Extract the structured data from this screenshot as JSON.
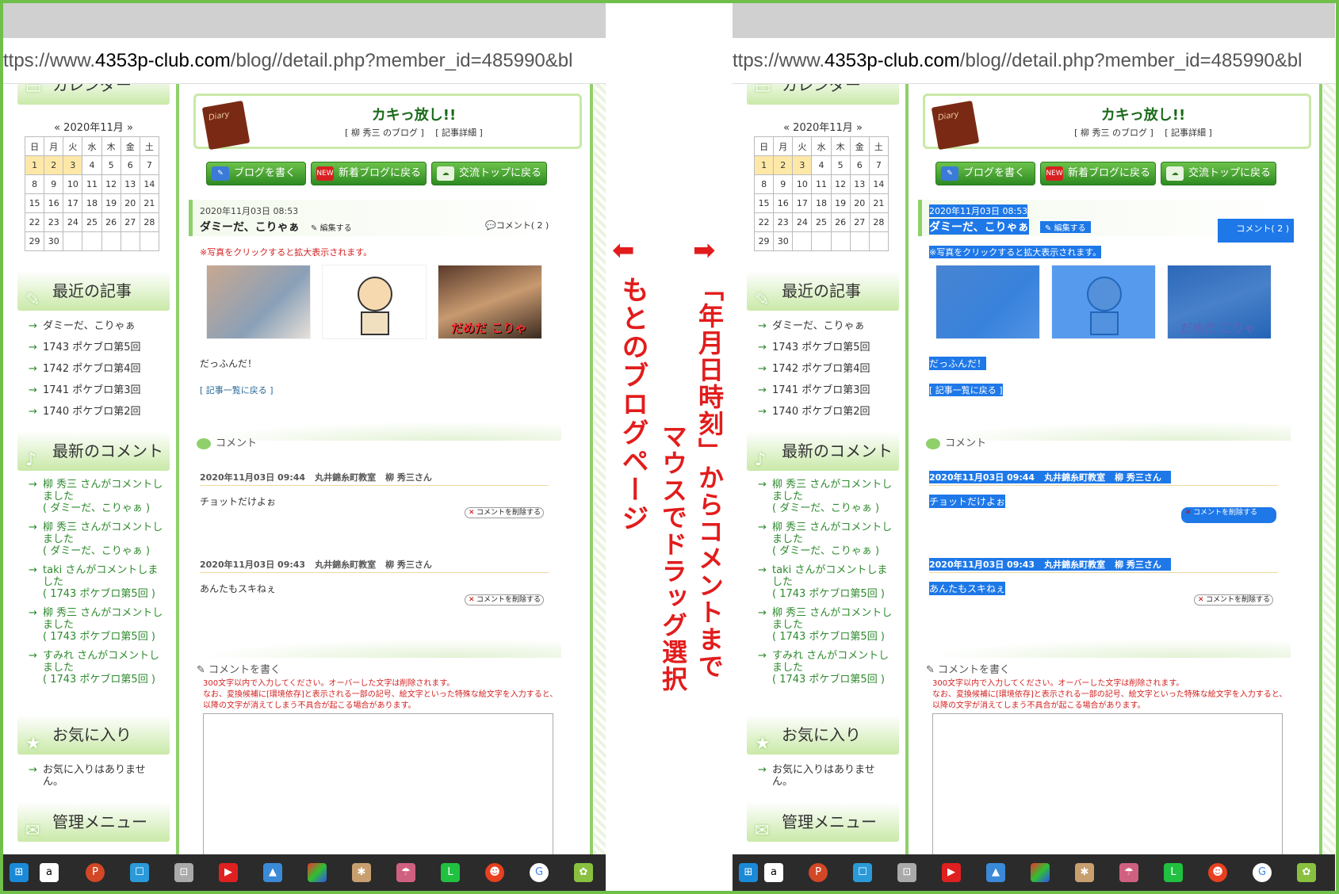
{
  "url": {
    "prefix": "ttps://www.",
    "host": "4353p-club.com",
    "path": "/blog//detail.php?member_id=485990&bl"
  },
  "sidebar": {
    "calendar_title": "カレンダー",
    "calendar_month": "« 2020年11月 »",
    "weekdays": [
      "日",
      "月",
      "火",
      "水",
      "木",
      "金",
      "土"
    ],
    "weeks": [
      [
        "1",
        "2",
        "3",
        "4",
        "5",
        "6",
        "7"
      ],
      [
        "8",
        "9",
        "10",
        "11",
        "12",
        "13",
        "14"
      ],
      [
        "15",
        "16",
        "17",
        "18",
        "19",
        "20",
        "21"
      ],
      [
        "22",
        "23",
        "24",
        "25",
        "26",
        "27",
        "28"
      ],
      [
        "29",
        "30",
        "",
        "",
        "",
        "",
        ""
      ]
    ],
    "recent_title": "最近の記事",
    "recent_posts": [
      "ダミーだ、こりゃぁ",
      "1743 ポケブロ第5回",
      "1742 ポケブロ第4回",
      "1741 ポケブロ第3回",
      "1740 ポケブロ第2回"
    ],
    "comments_title": "最新のコメント",
    "comments": [
      {
        "who": "柳 秀三 さんがコメントしました",
        "post": "( ダミーだ、こりゃぁ )"
      },
      {
        "who": "柳 秀三 さんがコメントしました",
        "post": "( ダミーだ、こりゃぁ )"
      },
      {
        "who": "taki さんがコメントしました",
        "post": "( 1743 ポケブロ第5回 )"
      },
      {
        "who": "柳 秀三 さんがコメントしました",
        "post": "( 1743 ポケブロ第5回 )"
      },
      {
        "who": "すみれ さんがコメントしました",
        "post": "( 1743 ポケブロ第5回 )"
      }
    ],
    "fav_title": "お気に入り",
    "fav_empty": "お気に入りはありません。",
    "admin_title": "管理メニュー"
  },
  "main": {
    "diary_label": "Diary",
    "blog_title": "カキっ放し!!",
    "blog_sub": "[ 柳 秀三 のブログ ]　 [ 記事詳細 ]",
    "buttons": [
      "ブログを書く",
      "新着ブログに戻る",
      "交流トップに戻る"
    ],
    "new_badge": "NEW",
    "entry_date": "2020年11月03日 08:53",
    "entry_title": "ダミーだ、こりゃぁ",
    "edit_label": "編集する",
    "comment_count": "コメント( 2 )",
    "notice": "※写真をクリックすると拡大表示されます。",
    "thumb3_caption": "だめだ こりゃ",
    "body_text": "だっふんだ！",
    "back_link": "[ 記事一覧に戻る ]",
    "comments_head": "コメント",
    "comments": [
      {
        "date": "2020年11月03日 09:44",
        "place": "丸井錦糸町教室",
        "name": "柳 秀三さん",
        "body": "チョットだけよぉ",
        "delete": "コメントを削除する"
      },
      {
        "date": "2020年11月03日 09:43",
        "place": "丸井錦糸町教室",
        "name": "柳 秀三さん",
        "body": "あんたもスキねぇ",
        "delete": "コメントを削除する"
      }
    ],
    "write_head": "コメントを書く",
    "write_note1": "300文字以内で入力してください。オーバーした文字は削除されます。",
    "write_note2": "なお、変換候補に[環境依存]と表示される一部の記号、絵文字といった特殊な絵文字を入力すると、以降の文字が消えてしまう不具合が起こる場合があります。"
  },
  "annotations": {
    "left_arrow": "⬅",
    "left_label": "もとのブログページ",
    "right_arrow": "➡",
    "right_label1": "「年月日時刻」からコメントまで",
    "right_label2": "マウスでドラッグ選択"
  },
  "colors": {
    "accent_green": "#6fbf4a",
    "selection_blue": "#1e78e8",
    "annotation_red": "#e21c1c"
  }
}
